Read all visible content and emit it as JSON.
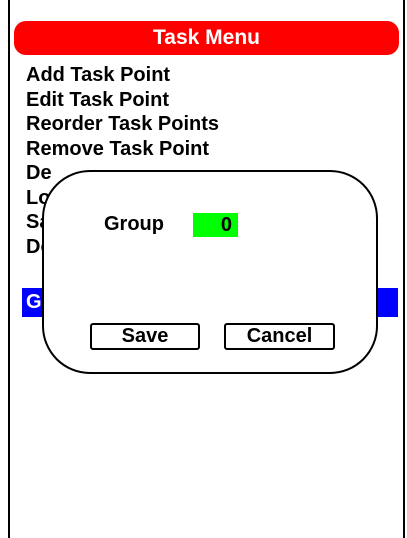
{
  "title_bar": {
    "title": "Task Menu",
    "color": "#ff0000"
  },
  "menu": {
    "items": [
      {
        "label": "Add Task Point"
      },
      {
        "label": "Edit Task Point"
      },
      {
        "label": "Reorder Task Points"
      },
      {
        "label": "Remove Task Point"
      },
      {
        "label": "De"
      },
      {
        "label": "Lo"
      },
      {
        "label": "Sa"
      },
      {
        "label": "Do"
      },
      {
        "label": "G"
      }
    ],
    "selected_index": 8,
    "selected_color": "#0000ff"
  },
  "dialog": {
    "group_label": "Group",
    "group_value": "0",
    "group_value_color": "#00ff00",
    "save_label": "Save",
    "cancel_label": "Cancel"
  }
}
